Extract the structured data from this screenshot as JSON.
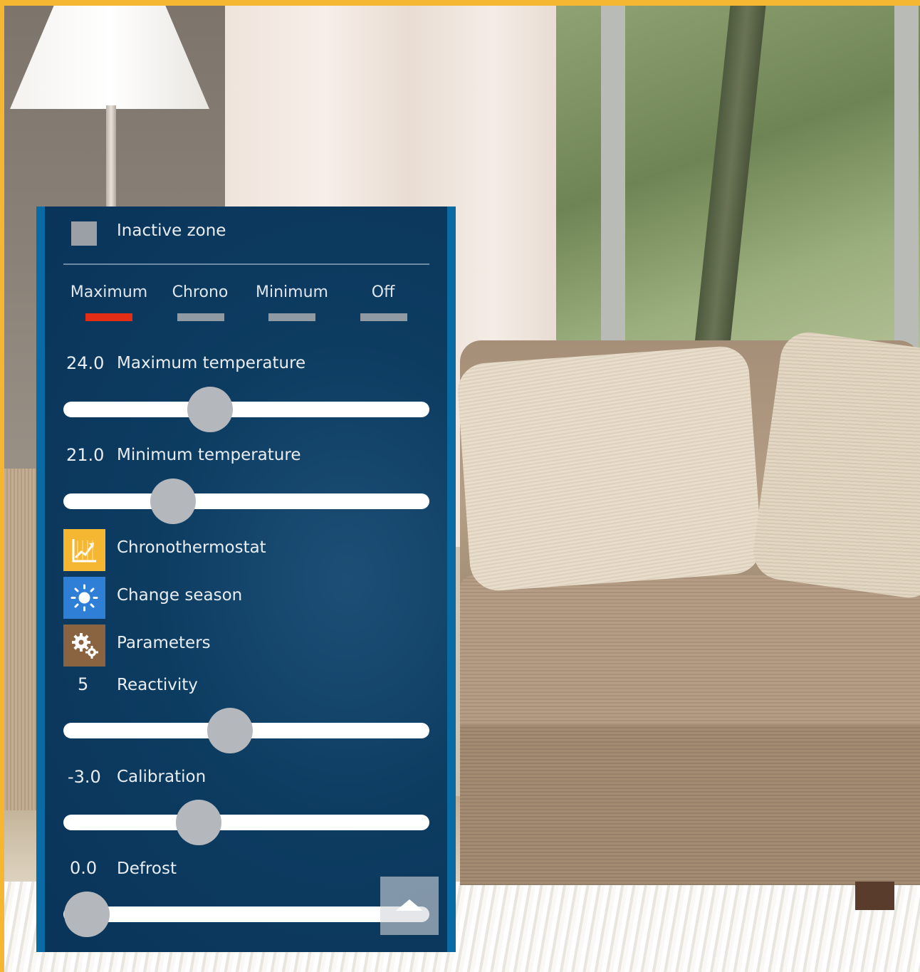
{
  "zone": {
    "label": "Inactive zone",
    "checkbox_color": "#9aa0a6"
  },
  "modes": {
    "items": [
      {
        "label": "Maximum",
        "active": true
      },
      {
        "label": "Chrono",
        "active": false
      },
      {
        "label": "Minimum",
        "active": false
      },
      {
        "label": "Off",
        "active": false
      }
    ],
    "active_color": "#e32d14",
    "inactive_color": "#8f9aa3"
  },
  "settings": {
    "max_temp": {
      "value": "24.0",
      "label": "Maximum temperature",
      "level": 0.4
    },
    "min_temp": {
      "value": "21.0",
      "label": "Minimum temperature",
      "level": 0.3
    },
    "reactivity": {
      "value": "5",
      "label": "Reactivity",
      "level": 0.455
    },
    "calibration": {
      "value": "-3.0",
      "label": "Calibration",
      "level": 0.37
    },
    "defrost": {
      "value": "0.0",
      "label": "Defrost",
      "level": 0.065
    }
  },
  "menu": {
    "chronothermostat": {
      "label": "Chronothermostat",
      "icon": "chart-icon",
      "color": "#f5b731"
    },
    "change_season": {
      "label": "Change season",
      "icon": "sun-icon",
      "color": "#2f7fd6"
    },
    "parameters": {
      "label": "Parameters",
      "icon": "gears-icon",
      "color": "#8a6440"
    }
  },
  "scroll_top": {
    "icon": "chevron-up-icon"
  }
}
